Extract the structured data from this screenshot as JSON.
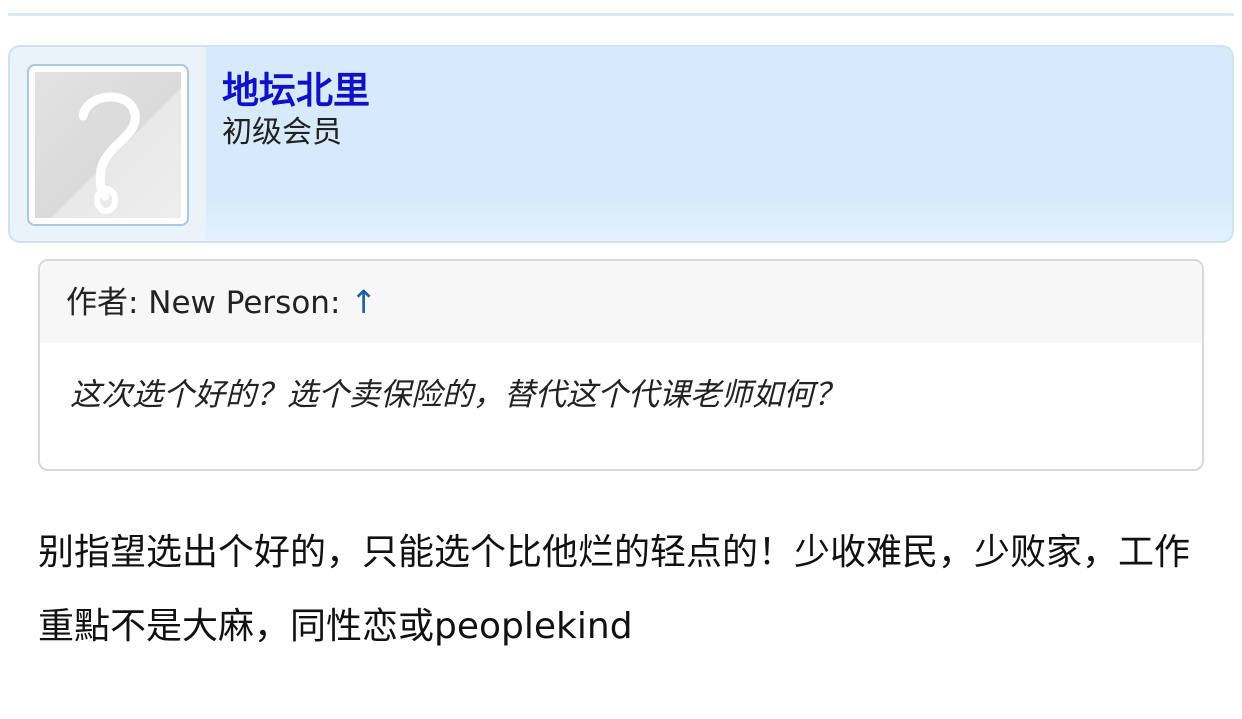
{
  "user": {
    "name": "地坛北里",
    "rank": "初级会员",
    "avatar_icon": "question-mark-placeholder-icon"
  },
  "quote": {
    "author_label": "作者: New Person: ",
    "arrow": "↑",
    "body": "这次选个好的？选个卖保险的，替代这个代课老师如何？"
  },
  "reply": {
    "text": "别指望选出个好的，只能选个比他烂的轻点的！少收难民，少败家，工作重點不是大麻，同性恋或peoplekind"
  },
  "colors": {
    "username": "#1010c8",
    "header_bg": "#d6eafb",
    "link_arrow": "#1a5fa8"
  }
}
